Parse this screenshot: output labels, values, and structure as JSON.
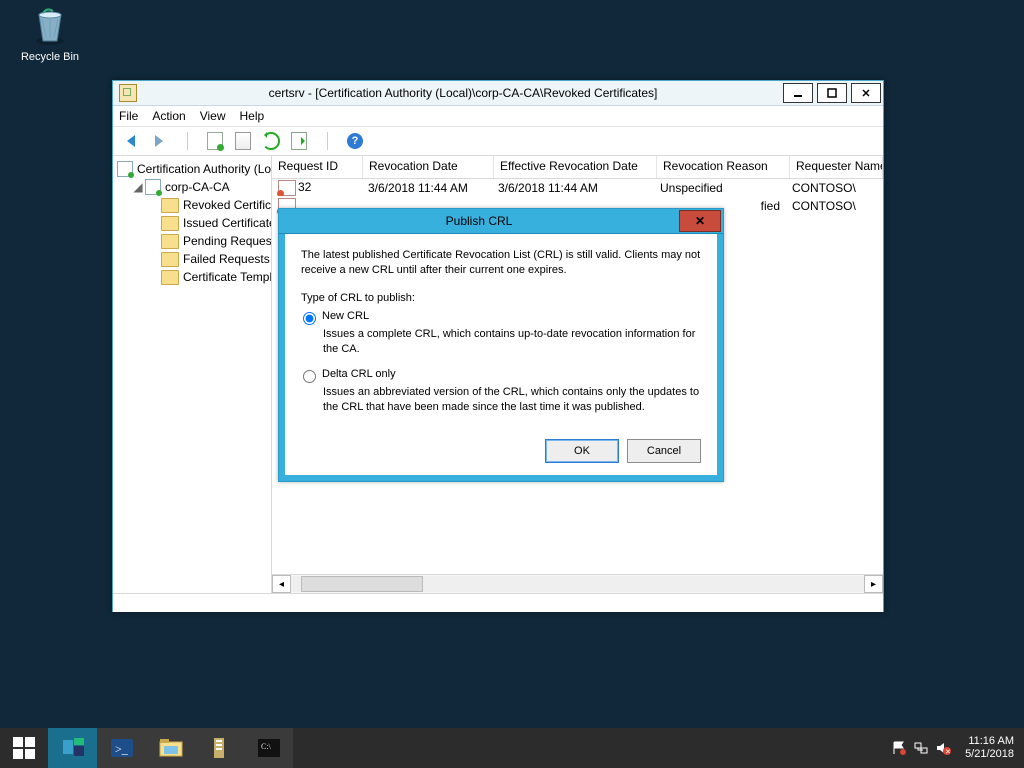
{
  "desktop": {
    "recycle_label": "Recycle Bin"
  },
  "window": {
    "title": "certsrv - [Certification Authority (Local)\\corp-CA-CA\\Revoked Certificates]",
    "menu": [
      "File",
      "Action",
      "View",
      "Help"
    ],
    "tree": {
      "root": "Certification Authority (Local)",
      "ca": "corp-CA-CA",
      "items": [
        "Revoked Certificates",
        "Issued Certificates",
        "Pending Requests",
        "Failed Requests",
        "Certificate Templates"
      ]
    },
    "columns": [
      "Request ID",
      "Revocation Date",
      "Effective Revocation Date",
      "Revocation Reason",
      "Requester Name"
    ],
    "rows": [
      {
        "rid": "32",
        "rd": "3/6/2018 11:44 AM",
        "erd": "3/6/2018 11:44 AM",
        "rr": "Unspecified",
        "rn": "CONTOSO\\"
      },
      {
        "rid": "",
        "rd": "",
        "erd": "",
        "rr": "fied",
        "rn": "CONTOSO\\"
      }
    ]
  },
  "dialog": {
    "title": "Publish CRL",
    "message": "The latest published Certificate Revocation List (CRL) is still valid. Clients may not receive a new CRL until after their current one expires.",
    "type_label": "Type of CRL to publish:",
    "opt1": "New CRL",
    "opt1_desc": "Issues a complete CRL, which contains up-to-date revocation information for the CA.",
    "opt2": "Delta CRL only",
    "opt2_desc": "Issues an abbreviated version of the CRL, which contains only the updates to the CRL that have been made since the last time it was published.",
    "ok": "OK",
    "cancel": "Cancel"
  },
  "taskbar": {
    "time": "11:16 AM",
    "date": "5/21/2018"
  }
}
